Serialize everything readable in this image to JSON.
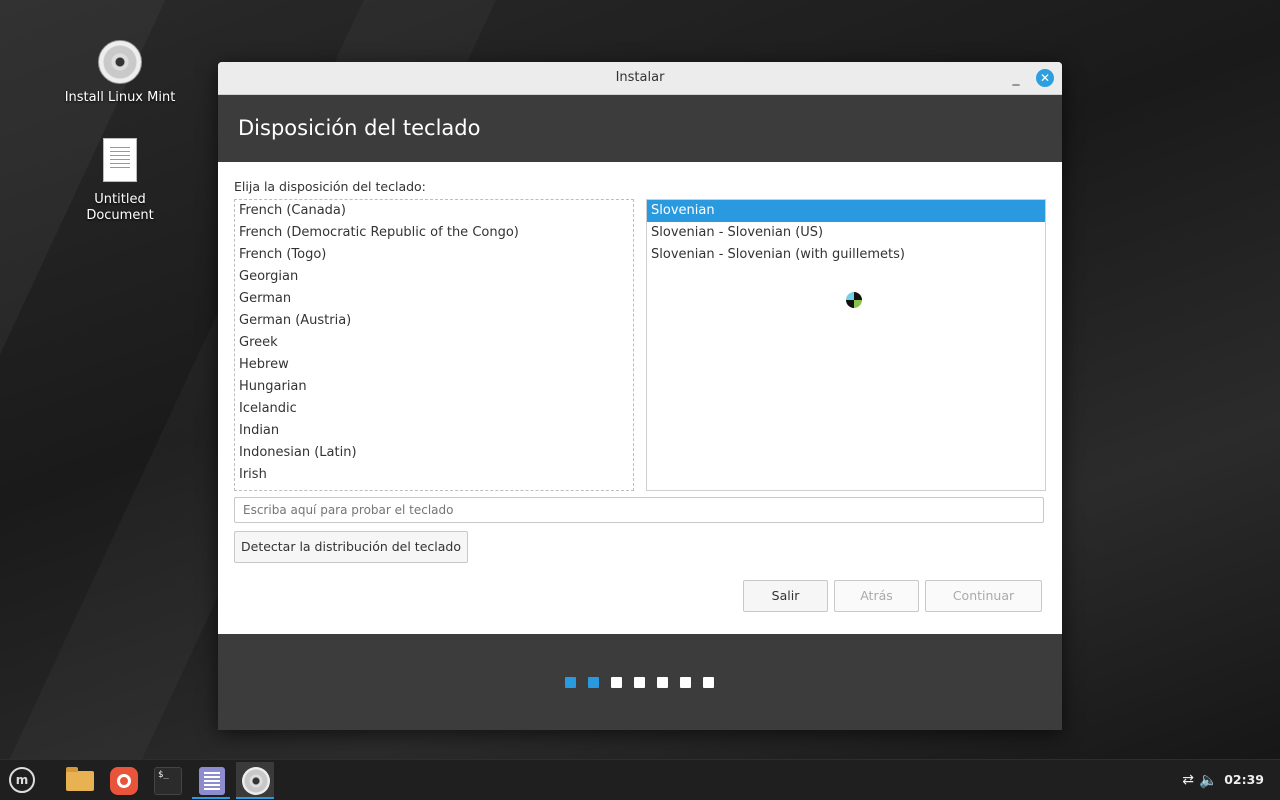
{
  "desktop": {
    "icons": [
      {
        "label": "Install Linux Mint"
      },
      {
        "label": "Untitled Document"
      }
    ]
  },
  "window": {
    "title": "Instalar",
    "minimize": "_",
    "close": "✕",
    "header": "Disposición del teclado",
    "prompt": "Elija la disposición del teclado:",
    "layouts": [
      "French (Canada)",
      "French (Democratic Republic of the Congo)",
      "French (Togo)",
      "Georgian",
      "German",
      "German (Austria)",
      "Greek",
      "Hebrew",
      "Hungarian",
      "Icelandic",
      "Indian",
      "Indonesian (Latin)",
      "Irish"
    ],
    "variants": [
      "Slovenian",
      "Slovenian - Slovenian (US)",
      "Slovenian - Slovenian (with guillemets)"
    ],
    "selected_variant": "Slovenian",
    "test_placeholder": "Escriba aquí para probar el teclado",
    "detect_button": "Detectar la distribución del teclado",
    "buttons": {
      "quit": "Salir",
      "back": "Atrás",
      "continue": "Continuar"
    },
    "progress": {
      "total_steps": 7,
      "completed_steps": 2
    }
  },
  "taskbar": {
    "clock": "02:39",
    "accent": "#2a9ae0"
  }
}
